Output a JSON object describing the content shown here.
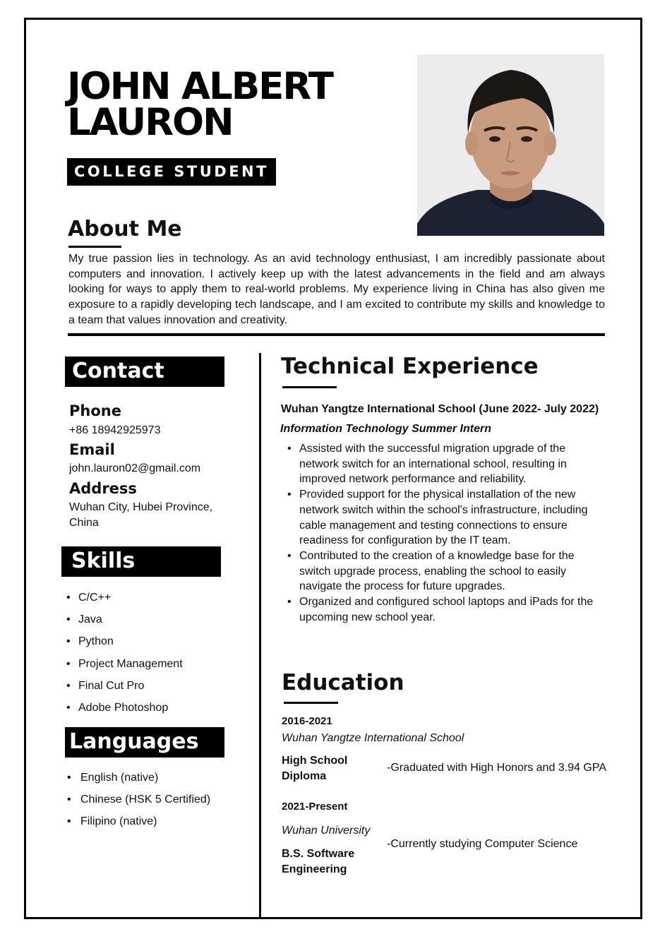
{
  "header": {
    "name_line1": "JOHN ALBERT",
    "name_line2": "LAURON",
    "role": "COLLEGE STUDENT"
  },
  "about": {
    "title": "About Me",
    "text": "My true passion lies in technology. As an avid technology enthusiast, I am incredibly passionate about computers and innovation. I actively keep up with the latest advancements in the field and am always looking for ways to apply them to real-world problems. My experience living in China has also given me exposure to a rapidly developing tech landscape, and I am excited to contribute my skills and knowledge to a team that values innovation and creativity."
  },
  "contact": {
    "title": "Contact",
    "phone_label": "Phone",
    "phone": "+86 18942925973",
    "email_label": "Email",
    "email": "john.lauron02@gmail.com",
    "address_label": "Address",
    "address_line1": "Wuhan City, Hubei Province,",
    "address_line2": "China"
  },
  "skills": {
    "title": "Skills",
    "items": [
      "C/C++",
      "Java",
      "Python",
      "Project Management",
      "Final Cut Pro",
      "Adobe Photoshop"
    ]
  },
  "languages": {
    "title": "Languages",
    "items": [
      "English (native)",
      "Chinese (HSK 5 Certified)",
      "Filipino (native)"
    ]
  },
  "experience": {
    "title": "Technical Experience",
    "org": "Wuhan Yangtze International School (June 2022- July 2022)",
    "position": "Information Technology Summer Intern",
    "bullets": [
      "Assisted with the successful migration upgrade of the network switch for an international school, resulting in improved network performance and reliability.",
      "Provided support for the physical installation of the new network switch within the school's infrastructure, including cable management and testing connections to ensure readiness for configuration by the IT team.",
      "Contributed to the creation of a knowledge base for the switch upgrade process, enabling the school to easily navigate the process for future upgrades.",
      "Organized and configured school laptops and iPads for the upcoming new school year."
    ]
  },
  "education": {
    "title": "Education",
    "entries": [
      {
        "years": "2016-2021",
        "school": "Wuhan Yangtze International School",
        "degree_line1": "High School",
        "degree_line2": "Diploma",
        "note": "-Graduated with High Honors and 3.94 GPA"
      },
      {
        "years": "2021-Present",
        "school": "Wuhan University",
        "degree_line1": "B.S. Software",
        "degree_line2": "Engineering",
        "note": "-Currently studying Computer Science"
      }
    ]
  }
}
